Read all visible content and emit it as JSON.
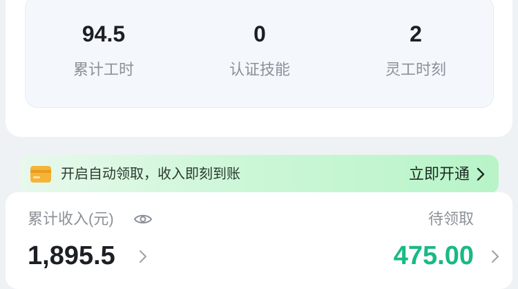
{
  "stats": [
    {
      "value": "94.5",
      "label": "累计工时"
    },
    {
      "value": "0",
      "label": "认证技能"
    },
    {
      "value": "2",
      "label": "灵工时刻"
    }
  ],
  "banner": {
    "icon": "wallet-icon",
    "text": "开启自动领取，收入即刻到账",
    "cta": "立即开通",
    "cta_icon": "chevron-right-icon"
  },
  "income": {
    "label": "累计收入(元)",
    "visibility_icon": "eye-icon",
    "value": "1,895.5",
    "pending_label": "待领取",
    "pending_value": "475.00",
    "accent_color": "#19b985"
  }
}
